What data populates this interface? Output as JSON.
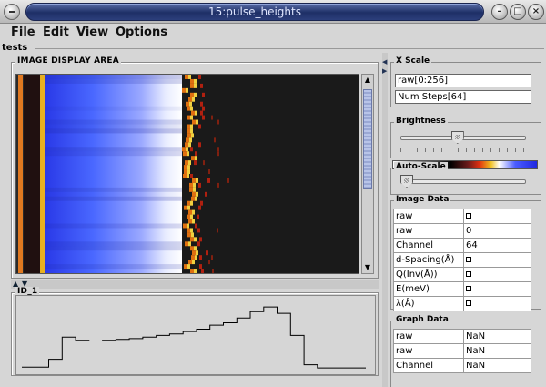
{
  "window": {
    "title": "15:pulse_heights"
  },
  "menu": [
    "File",
    "Edit",
    "View",
    "Options"
  ],
  "tests_label": "tests",
  "image_area": {
    "title": "IMAGE DISPLAY AREA"
  },
  "id_area": {
    "title": "ID_1"
  },
  "chart_data": {
    "type": "line",
    "title": "",
    "xlabel": "",
    "ylabel": "",
    "x": [
      0,
      10,
      20,
      30,
      40,
      50,
      60,
      70,
      80,
      90,
      100,
      110,
      120,
      130,
      140,
      150,
      160,
      170,
      180,
      190,
      200,
      210,
      220,
      230,
      240,
      250,
      256
    ],
    "values": [
      2,
      2,
      12,
      40,
      36,
      35,
      36,
      37,
      38,
      40,
      42,
      44,
      47,
      50,
      55,
      58,
      64,
      72,
      78,
      70,
      42,
      5,
      1,
      1,
      1,
      1,
      1
    ],
    "ylim": [
      0,
      85
    ]
  },
  "right_panel": {
    "x_scale": {
      "title": "X Scale",
      "field1": "raw[0:256]",
      "field2": "Num Steps[64]"
    },
    "brightness": {
      "title": "Brightness",
      "value": 0.45
    },
    "auto_scale": {
      "title": "Auto-Scale",
      "value": 0.0
    },
    "image_data": {
      "title": "Image Data",
      "rows": [
        {
          "k": "raw",
          "v": "",
          "cb": true
        },
        {
          "k": "raw",
          "v": "0",
          "cb": false
        },
        {
          "k": "Channel",
          "v": "64",
          "cb": false
        },
        {
          "k": "d-Spacing(Å)",
          "v": "",
          "cb": true
        },
        {
          "k": "Q(Inv(Å))",
          "v": "",
          "cb": true
        },
        {
          "k": "E(meV)",
          "v": "",
          "cb": true
        },
        {
          "k": "λ(Å)",
          "v": "",
          "cb": true
        }
      ]
    },
    "graph_data": {
      "title": "Graph Data",
      "rows": [
        {
          "k": "raw",
          "v": "NaN"
        },
        {
          "k": "raw",
          "v": "NaN"
        },
        {
          "k": "Channel",
          "v": "NaN"
        }
      ]
    }
  }
}
